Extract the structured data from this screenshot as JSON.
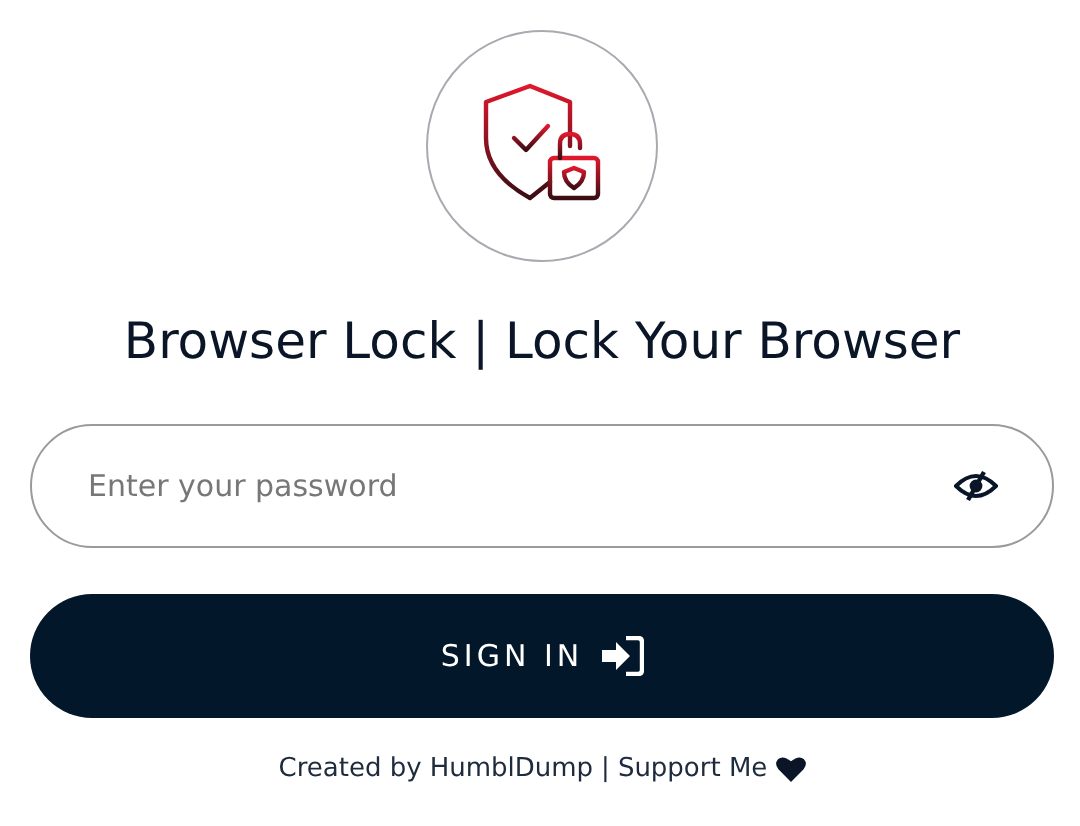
{
  "title": "Browser Lock | Lock Your Browser",
  "password": {
    "placeholder": "Enter your password",
    "visible": false
  },
  "sign_in_button": {
    "label": "SIGN IN"
  },
  "footer": {
    "text": "Created by",
    "author_link": "HumblDump",
    "separator": "|",
    "support_link": "Support Me"
  }
}
